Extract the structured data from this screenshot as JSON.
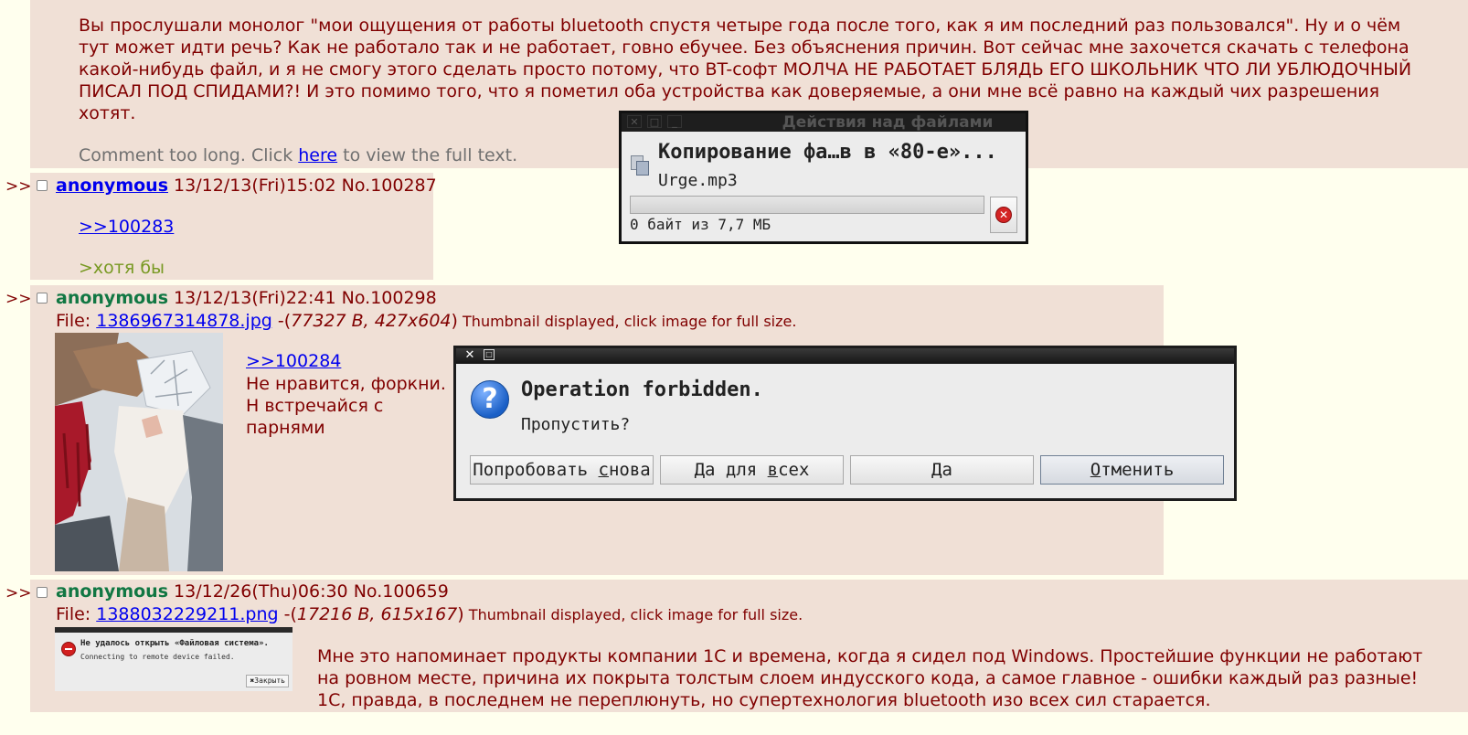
{
  "top_post": {
    "text": "Вы прослушали монолог \"мои ощущения от работы bluetooth спустя четыре года после того, как я им последний раз пользовался\". Ну и о чём тут может идти речь? Как не работало так и не работает, говно ебучее. Без объяснения причин. Вот сейчас мне захочется скачать с телефона какой-нибудь файл, и я не смогу этого сделать просто потому, что BT-софт МОЛЧА НЕ РАБОТАЕТ БЛЯДЬ ЕГО ШКОЛЬНИК ЧТО ЛИ УБЛЮДОЧНЫЙ ПИСАЛ ПОД СПИДАМИ?! И это помимо того, что я пометил оба устройства как доверяемые, а они мне всё равно на каждый чих разрешения хотят.",
    "too_long_prefix": "Comment too long. Click ",
    "too_long_link": "here",
    "too_long_suffix": " to view the full text."
  },
  "posts": [
    {
      "arrows": ">>",
      "name": "anonymous",
      "datetime": "13/12/13(Fri)15:02",
      "number": "No.100287",
      "quote_link": ">>100283",
      "greentext": ">хотя бы"
    },
    {
      "arrows": ">>",
      "name": "anonymous",
      "datetime": "13/12/13(Fri)22:41",
      "number": "No.100298",
      "file_label": "File: ",
      "file_name": "1386967314878.jpg",
      "file_sep": " -(",
      "file_meta": "77327 B, 427x604",
      "file_close": ")",
      "thumb_note": " Thumbnail displayed, click image for full size.",
      "quote_link": ">>100284",
      "text": "Не нравится, форкни. Н встречайся с парнями"
    },
    {
      "arrows": ">>",
      "name": "anonymous",
      "datetime": "13/12/26(Thu)06:30",
      "number": "No.100659",
      "file_label": "File: ",
      "file_name": "1388032229211.png",
      "file_sep": " -(",
      "file_meta": "17216 B, 615x167",
      "file_close": ")",
      "thumb_note": " Thumbnail displayed, click image for full size.",
      "thumb_error": "Не удалось открыть «Файловая система».",
      "thumb_detail": "Connecting to remote device failed.",
      "thumb_close": "Закрыть",
      "text": "Мне это напоминает продукты компании 1С и времена, когда я сидел под Windows. Простейшие функции не работают на ровном месте, причина их покрыта толстым слоем индусского кода, а самое главное - ошибки каждый раз разные! 1С, правда, в последнем не переплюнуть, но супертехнология bluetooth изо всех сил старается."
    }
  ],
  "copy_dialog": {
    "title": "Действия над файлами",
    "heading": "Копирование фа…в в «80-е»...",
    "filename": "Urge.mp3",
    "status": "0 байт из 7,7 МБ",
    "progress": 0
  },
  "error_dialog": {
    "heading": "Operation forbidden.",
    "question": "Пропустить?",
    "buttons": {
      "retry": {
        "pre": "Попробовать ",
        "u": "с",
        "post": "нова"
      },
      "yes_all": {
        "pre": "Да для ",
        "u": "в",
        "post": "сех"
      },
      "yes": {
        "pre": "Да",
        "u": "",
        "post": ""
      },
      "cancel": {
        "pre": "",
        "u": "О",
        "post": "тменить"
      }
    }
  },
  "colors": {
    "background": "#ffffee",
    "post_bg": "#f0e0d6",
    "text": "#800000",
    "name": "#117743",
    "link": "#0000ee",
    "greentext": "#789922"
  }
}
